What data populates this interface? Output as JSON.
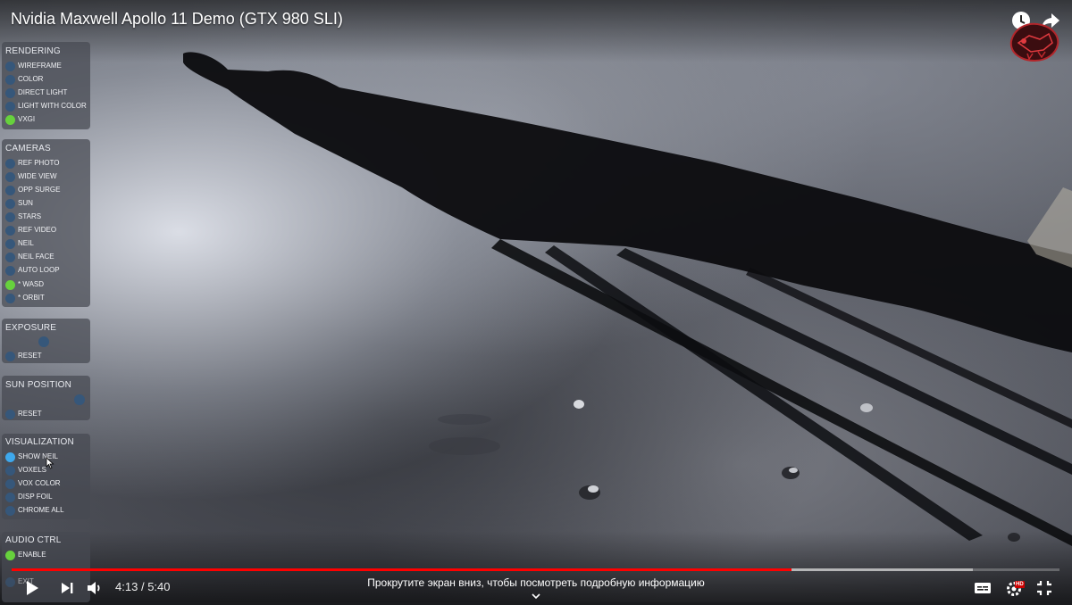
{
  "video": {
    "title": "Nvidia Maxwell Apollo 11 Demo (GTX 980 SLI)",
    "top_icons": [
      "clock-icon",
      "share-icon"
    ],
    "channel_logo": "channel-logo"
  },
  "panels": {
    "rendering": {
      "title": "RENDERING",
      "options": [
        {
          "label": "WIREFRAME",
          "state": "off"
        },
        {
          "label": "COLOR",
          "state": "off"
        },
        {
          "label": "DIRECT LIGHT",
          "state": "off"
        },
        {
          "label": "LIGHT WITH COLOR",
          "state": "off"
        },
        {
          "label": "VXGI",
          "state": "on"
        }
      ]
    },
    "cameras": {
      "title": "CAMERAS",
      "options": [
        {
          "label": "REF PHOTO",
          "state": "off"
        },
        {
          "label": "WIDE VIEW",
          "state": "off"
        },
        {
          "label": "OPP SURGE",
          "state": "off"
        },
        {
          "label": "SUN",
          "state": "off"
        },
        {
          "label": "STARS",
          "state": "off"
        },
        {
          "label": "REF VIDEO",
          "state": "off"
        },
        {
          "label": "NEIL",
          "state": "off"
        },
        {
          "label": "NEIL FACE",
          "state": "off"
        },
        {
          "label": "AUTO LOOP",
          "state": "off"
        },
        {
          "label": "* WASD",
          "state": "on"
        },
        {
          "label": "* ORBIT",
          "state": "off"
        }
      ]
    },
    "exposure": {
      "title": "EXPOSURE",
      "reset_label": "RESET",
      "slider_value": 0.45
    },
    "sun_position": {
      "title": "SUN POSITION",
      "reset_label": "RESET",
      "slider_value": 0.85
    },
    "visualization": {
      "title": "VISUALIZATION",
      "options": [
        {
          "label": "SHOW NEIL",
          "state": "hover"
        },
        {
          "label": "VOXELS",
          "state": "off"
        },
        {
          "label": "VOX COLOR",
          "state": "off"
        },
        {
          "label": "DISP FOIL",
          "state": "off"
        },
        {
          "label": "CHROME ALL",
          "state": "off"
        }
      ]
    },
    "audio": {
      "title": "AUDIO CTRL",
      "options": [
        {
          "label": "ENABLE",
          "state": "on"
        }
      ],
      "partial_label": "EXIT"
    }
  },
  "player": {
    "current_time": "4:13",
    "separator": "/",
    "duration": "5:40",
    "played_fraction": 0.744,
    "buffered_fraction": 0.917,
    "scroll_hint": "Прокрутите экран вниз, чтобы посмотреть подробную информацию",
    "controls_left": [
      "play-icon",
      "next-icon",
      "volume-icon"
    ],
    "controls_right": [
      "subtitles-icon",
      "settings-icon",
      "fullscreen-exit-icon"
    ],
    "settings_badge": "HD",
    "colors": {
      "played": "#ff0000",
      "accent_green": "#67d13d",
      "accent_blue": "#3ea8ec"
    }
  }
}
